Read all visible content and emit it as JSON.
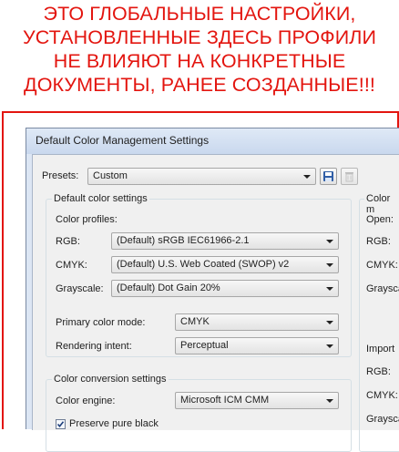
{
  "warning": {
    "lines": [
      "ЭТО ГЛОБАЛЬНЫЕ НАСТРОЙКИ,",
      "УСТАНОВЛЕННЫЕ ЗДЕСЬ ПРОФИЛИ",
      "НЕ ВЛИЯЮТ НА КОНКРЕТНЫЕ",
      "ДОКУМЕНТЫ, РАНЕЕ СОЗДАННЫЕ!!!"
    ],
    "color": "#e3150f"
  },
  "dialog": {
    "title": "Default Color Management Settings",
    "presets_label": "Presets:",
    "presets_value": "Custom",
    "save_icon": "floppy-disk-icon",
    "delete_icon": "trash-icon",
    "default_color_settings": {
      "group_title": "Default color settings",
      "color_profiles_label": "Color profiles:",
      "rgb_label": "RGB:",
      "rgb_value": "(Default) sRGB IEC61966-2.1",
      "cmyk_label": "CMYK:",
      "cmyk_value": "(Default) U.S. Web Coated (SWOP) v2",
      "grayscale_label": "Grayscale:",
      "grayscale_value": "(Default) Dot Gain 20%",
      "primary_mode_label": "Primary color mode:",
      "primary_mode_value": "CMYK",
      "rendering_intent_label": "Rendering intent:",
      "rendering_intent_value": "Perceptual"
    },
    "color_conversion": {
      "group_title": "Color conversion settings",
      "engine_label": "Color engine:",
      "engine_value": "Microsoft ICM CMM",
      "preserve_black_label": "Preserve pure black",
      "preserve_black_checked": true
    },
    "right_panel": {
      "title_partial": "Color m",
      "open_label": "Open:",
      "rgb_label": "RGB:",
      "cmyk_label": "CMYK:",
      "grayscale_label": "Graysca",
      "import_label": "Import",
      "rgb2_label": "RGB:",
      "cmyk2_label": "CMYK:",
      "grayscale2_label": "Graysca"
    }
  }
}
